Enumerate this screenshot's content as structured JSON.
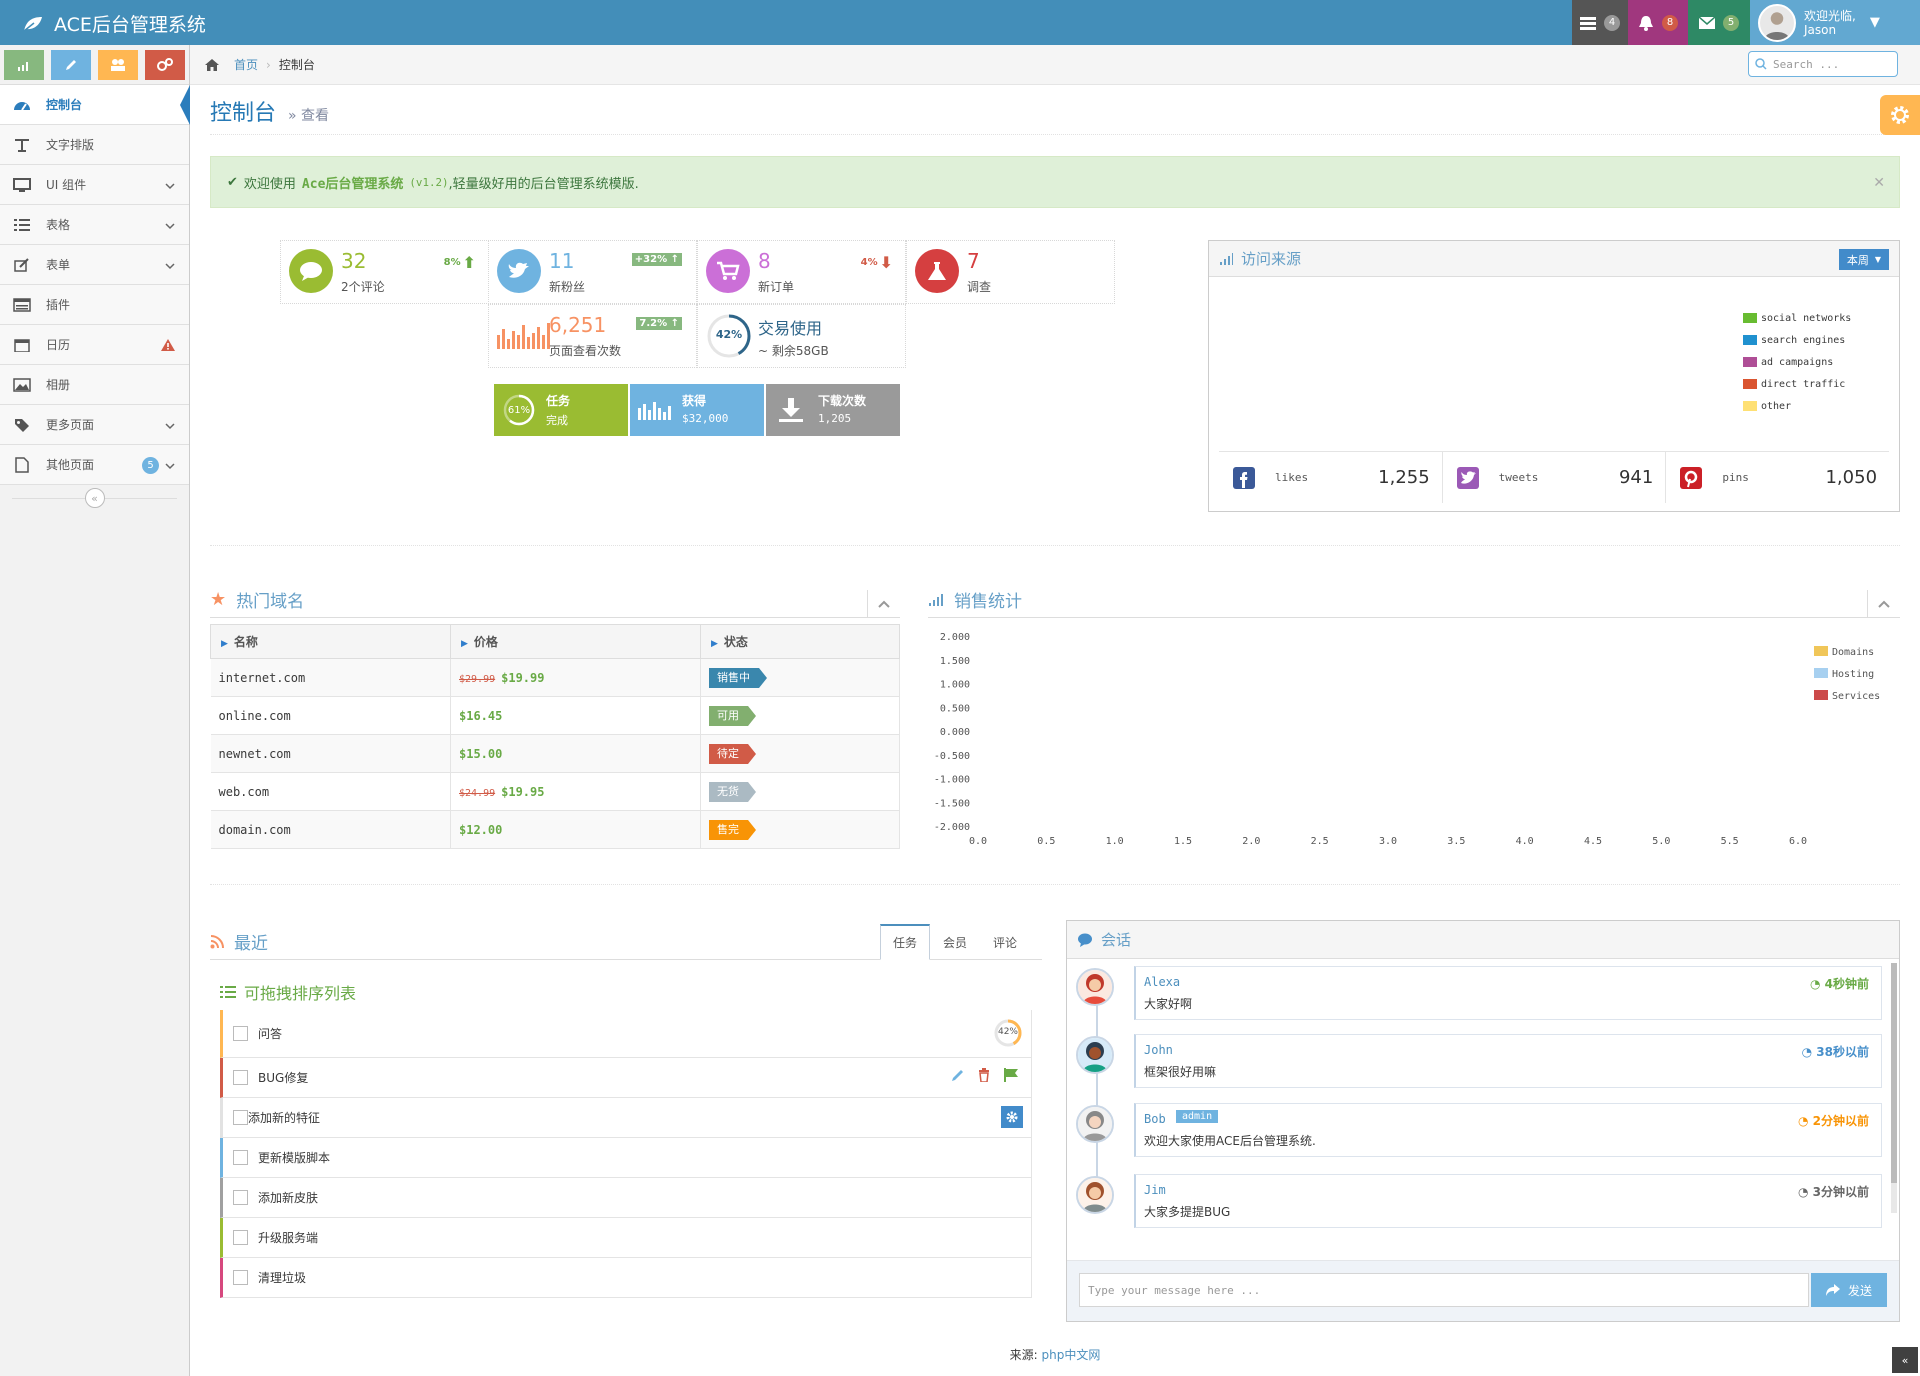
{
  "navbar": {
    "brand": "ACE后台管理系统",
    "tasks_count": "4",
    "notifications_count": "8",
    "messages_count": "5",
    "user_greeting": "欢迎光临,",
    "user_name": "Jason"
  },
  "sidebar": {
    "items": [
      {
        "label": "控制台"
      },
      {
        "label": "文字排版"
      },
      {
        "label": "UI 组件"
      },
      {
        "label": "表格"
      },
      {
        "label": "表单"
      },
      {
        "label": "插件"
      },
      {
        "label": "日历"
      },
      {
        "label": "相册"
      },
      {
        "label": "更多页面"
      },
      {
        "label": "其他页面",
        "badge": "5"
      }
    ]
  },
  "breadcrumb": {
    "home": "首页",
    "current": "控制台"
  },
  "search": {
    "placeholder": "Search ..."
  },
  "page": {
    "title": "控制台",
    "subtitle": "查看"
  },
  "alert": {
    "prefix": "欢迎使用",
    "brand": "Ace后台管理系统",
    "version": "(v1.2)",
    "suffix": ",轻量级好用的后台管理系统模版."
  },
  "infoboxes": {
    "comments": {
      "value": "32",
      "label": "2个评论",
      "stat": "8%"
    },
    "followers": {
      "value": "11",
      "label": "新粉丝",
      "badge": "+32%"
    },
    "orders": {
      "value": "8",
      "label": "新订单",
      "stat": "4%"
    },
    "surveys": {
      "value": "7",
      "label": "调查"
    },
    "pageviews": {
      "value": "6,251",
      "label": "页面查看次数",
      "badge": "7.2%"
    },
    "usage": {
      "value": "交易使用",
      "label": "~ 剩余58GB",
      "percent": "42%"
    }
  },
  "small_boxes": {
    "tasks": {
      "title": "任务",
      "sub": "完成",
      "percent": "61%"
    },
    "earnings": {
      "title": "获得",
      "sub": "$32,000"
    },
    "downloads": {
      "title": "下载次数",
      "sub": "1,205"
    }
  },
  "traffic": {
    "title": "访问来源",
    "period": "本周",
    "legend": [
      {
        "name": "social networks",
        "color": "#68bc31"
      },
      {
        "name": "search engines",
        "color": "#2091cf"
      },
      {
        "name": "ad campaigns",
        "color": "#af4e96"
      },
      {
        "name": "direct traffic",
        "color": "#da5430"
      },
      {
        "name": "other",
        "color": "#fee074"
      }
    ],
    "social": {
      "likes_label": "likes",
      "likes": "1,255",
      "tweets_label": "tweets",
      "tweets": "941",
      "pins_label": "pins",
      "pins": "1,050"
    }
  },
  "domains": {
    "title": "热门域名",
    "headers": [
      "名称",
      "价格",
      "状态"
    ],
    "rows": [
      {
        "name": "internet.com",
        "old": "$29.99",
        "price": "$19.99",
        "status": "销售中",
        "color": "#3a87ad"
      },
      {
        "name": "online.com",
        "old": "",
        "price": "$16.45",
        "status": "可用",
        "color": "#82af6f"
      },
      {
        "name": "newnet.com",
        "old": "",
        "price": "$15.00",
        "status": "待定",
        "color": "#d15b47"
      },
      {
        "name": "web.com",
        "old": "$24.99",
        "price": "$19.95",
        "status": "无货",
        "color": "#abbac3"
      },
      {
        "name": "domain.com",
        "old": "",
        "price": "$12.00",
        "status": "售完",
        "color": "#f89406"
      }
    ]
  },
  "sales": {
    "title": "销售统计"
  },
  "chart_data": {
    "type": "line",
    "title": "",
    "xlim": [
      0,
      6
    ],
    "ylim": [
      -2,
      2
    ],
    "x_ticks": [
      "0.0",
      "0.5",
      "1.0",
      "1.5",
      "2.0",
      "2.5",
      "3.0",
      "3.5",
      "4.0",
      "4.5",
      "5.0",
      "5.5",
      "6.0"
    ],
    "y_ticks": [
      "2.000",
      "1.500",
      "1.000",
      "0.500",
      "0.000",
      "-0.500",
      "-1.000",
      "-1.500",
      "-2.000"
    ],
    "series": [
      {
        "name": "Domains",
        "color": "#f0c659",
        "values": []
      },
      {
        "name": "Hosting",
        "color": "#a7d0f0",
        "values": []
      },
      {
        "name": "Services",
        "color": "#cc4a4a",
        "values": []
      }
    ],
    "legend": "top-right",
    "grid": false
  },
  "recent": {
    "title": "最近",
    "tabs": [
      "任务",
      "会员",
      "评论"
    ],
    "list_title": "可拖拽排序列表",
    "tasks": [
      {
        "label": "问答",
        "color": "#ffb752",
        "percent": "42%"
      },
      {
        "label": "BUG修复",
        "color": "#d15b47"
      },
      {
        "label": "添加新的特征",
        "color": "#e2e2e2"
      },
      {
        "label": "更新模版脚本",
        "color": "#6fb3e0"
      },
      {
        "label": "添加新皮肤",
        "color": "#a0a0a0"
      },
      {
        "label": "升级服务端",
        "color": "#9abc32"
      },
      {
        "label": "清理垃圾",
        "color": "#d6487e"
      }
    ]
  },
  "conversation": {
    "title": "会话",
    "messages": [
      {
        "name": "Alexa",
        "time": "4秒钟前",
        "text": "大家好啊",
        "time_color": "#69aa46"
      },
      {
        "name": "John",
        "time": "38秒以前",
        "text": "框架很好用嘛",
        "time_color": "#478fca"
      },
      {
        "name": "Bob",
        "tag": "admin",
        "time": "2分钟以前",
        "text": "欢迎大家使用ACE后台管理系统.",
        "time_color": "#f89406"
      },
      {
        "name": "Jim",
        "time": "3分钟以前",
        "text": "大家多提提BUG",
        "time_color": "#666666"
      }
    ],
    "input_placeholder": "Type your message here ...",
    "send_label": "发送"
  },
  "footer": {
    "prefix": "来源:",
    "link": "php中文网"
  },
  "colors": {
    "primary": "#438eb9",
    "sidebar": "#f2f2f2",
    "accent_orange": "#ffb752"
  }
}
